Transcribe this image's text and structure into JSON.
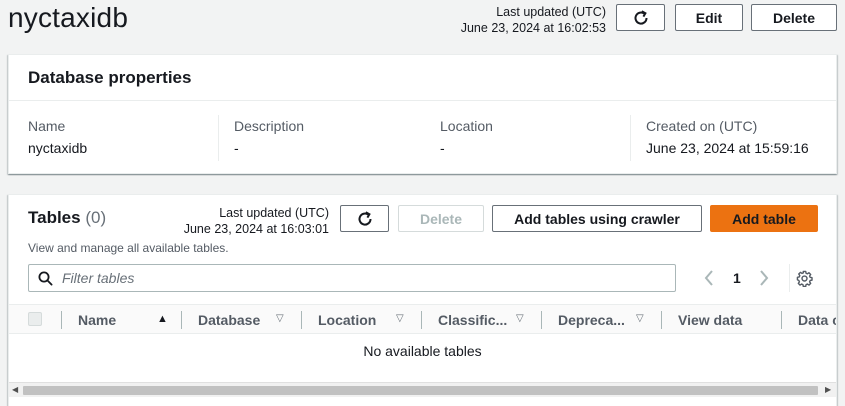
{
  "page": {
    "title": "nyctaxidb",
    "last_updated_label": "Last updated (UTC)",
    "last_updated_value": "June 23, 2024 at 16:02:53",
    "edit_label": "Edit",
    "delete_label": "Delete"
  },
  "properties": {
    "heading": "Database properties",
    "fields": [
      {
        "label": "Name",
        "value": "nyctaxidb"
      },
      {
        "label": "Description",
        "value": "-"
      },
      {
        "label": "Location",
        "value": "-"
      },
      {
        "label": "Created on (UTC)",
        "value": "June 23, 2024 at 15:59:16"
      }
    ]
  },
  "tables": {
    "heading": "Tables",
    "count": "(0)",
    "last_updated_label": "Last updated (UTC)",
    "last_updated_value": "June 23, 2024 at 16:03:01",
    "delete_label": "Delete",
    "crawler_label": "Add tables using crawler",
    "add_label": "Add table",
    "description": "View and manage all available tables.",
    "filter_placeholder": "Filter tables",
    "page_number": "1",
    "columns": [
      "Name",
      "Database",
      "Location",
      "Classific...",
      "Depreca...",
      "View data",
      "Data c"
    ],
    "empty_text": "No available tables"
  },
  "colors": {
    "primary_button": "#ec7211",
    "background": "#f2f3f3"
  },
  "icons": {
    "refresh": "refresh-icon",
    "search": "search-icon",
    "settings": "gear-icon"
  }
}
